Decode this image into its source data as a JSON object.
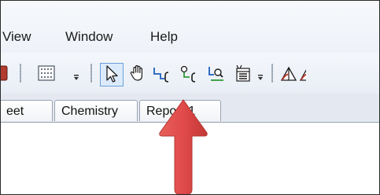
{
  "menu": {
    "items": [
      {
        "label": "View"
      },
      {
        "label": "Window"
      },
      {
        "label": "Help"
      }
    ]
  },
  "toolbar": {
    "icons": [
      "record-icon",
      "grid-icon",
      "pointer-arrow-icon",
      "hand-pan-icon",
      "step-wire-icon",
      "probe-connector-icon",
      "zoom-wire-icon",
      "table-list-icon",
      "triangle-tool-icon"
    ],
    "selected_tool": "pointer-arrow-icon"
  },
  "tabs": [
    {
      "label": "eet"
    },
    {
      "label": "Chemistry"
    },
    {
      "label": "Report-1"
    }
  ],
  "annotation": {
    "arrow_color": "#e04a4a"
  }
}
